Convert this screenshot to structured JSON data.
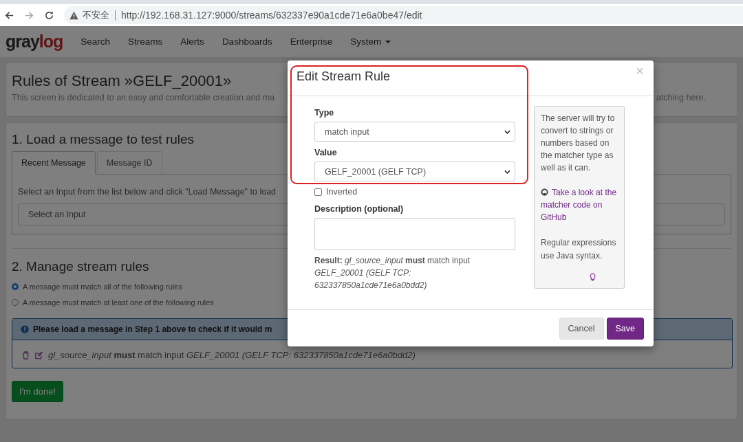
{
  "browser": {
    "security_label": "不安全",
    "url": "http://192.168.31.127:9000/streams/632337e90a1cde71e6a0be47/edit"
  },
  "nav": {
    "logo_main": "gray",
    "logo_accent": "log",
    "items": [
      {
        "label": "Search",
        "has_menu": false
      },
      {
        "label": "Streams",
        "has_menu": false
      },
      {
        "label": "Alerts",
        "has_menu": false
      },
      {
        "label": "Dashboards",
        "has_menu": false
      },
      {
        "label": "Enterprise",
        "has_menu": false
      },
      {
        "label": "System",
        "has_menu": true
      }
    ]
  },
  "page": {
    "title": "Rules of Stream »GELF_20001»",
    "description": "This screen is dedicated to an easy and comfortable creation and ma",
    "description_end": "atching here."
  },
  "load_section": {
    "heading": "1. Load a message to test rules",
    "tabs": [
      {
        "label": "Recent Message",
        "selected": true
      },
      {
        "label": "Message ID",
        "selected": false
      }
    ],
    "instruction": "Select an Input from the list below and click \"Load Message\" to load",
    "input_select": {
      "placeholder": "Select an Input"
    }
  },
  "rules_section": {
    "heading": "2. Manage stream rules",
    "match_options": [
      {
        "label": "A message must match all of the following rules",
        "selected": true
      },
      {
        "label": "A message must match at least one of the following rules",
        "selected": false
      }
    ],
    "notice": "Please load a message in Step 1 above to check if it would m",
    "rules": [
      {
        "text": "*gl_source_input* **must** match input *GELF_20001 (GELF TCP: 632337850a1cde71e6a0bdd2)*"
      }
    ],
    "done_button": "I'm done!"
  },
  "modal": {
    "title": "Edit Stream Rule",
    "close": "×",
    "type": {
      "label": "Type",
      "value": "match input"
    },
    "value": {
      "label": "Value",
      "value": "GELF_20001 (GELF TCP)"
    },
    "inverted": {
      "label": "Inverted",
      "checked": false
    },
    "description": {
      "label": "Description (optional)"
    },
    "result": "**Result:** *gl_source_input* **must** match input *GELF_20001 (GELF TCP: 632337850a1cde71e6a0bdd2)*",
    "help": {
      "intro": "The server will try to convert to strings or numbers based on the matcher type as well as it can.",
      "link": "Take a look at the matcher code on GitHub",
      "regex_note": "Regular expressions use Java syntax."
    },
    "buttons": [
      {
        "label": "Cancel",
        "kind": "default"
      },
      {
        "label": "Save",
        "kind": "primary"
      }
    ]
  }
}
